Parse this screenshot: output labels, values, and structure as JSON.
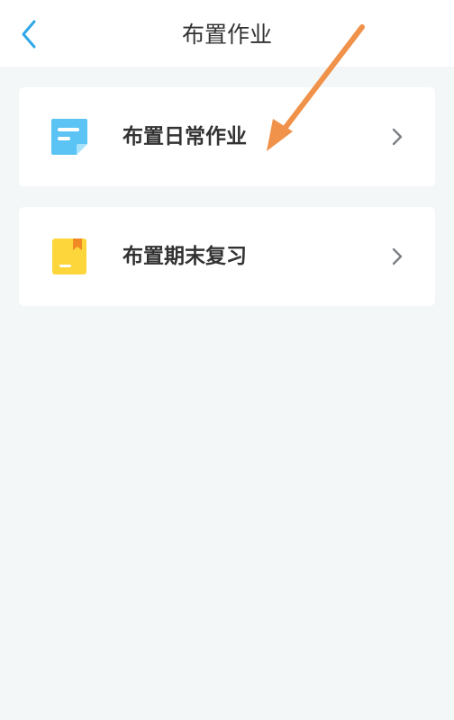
{
  "header": {
    "title": "布置作业",
    "back_icon": "chevron-left-icon"
  },
  "menu": {
    "items": [
      {
        "label": "布置日常作业",
        "icon": "note-icon",
        "icon_color": "#5bc4f5"
      },
      {
        "label": "布置期末复习",
        "icon": "bookmark-book-icon",
        "icon_color": "#fcd63a"
      }
    ]
  },
  "colors": {
    "accent": "#2fa7e6",
    "background": "#f4f7f8",
    "annotation_arrow": "#f0924a"
  }
}
